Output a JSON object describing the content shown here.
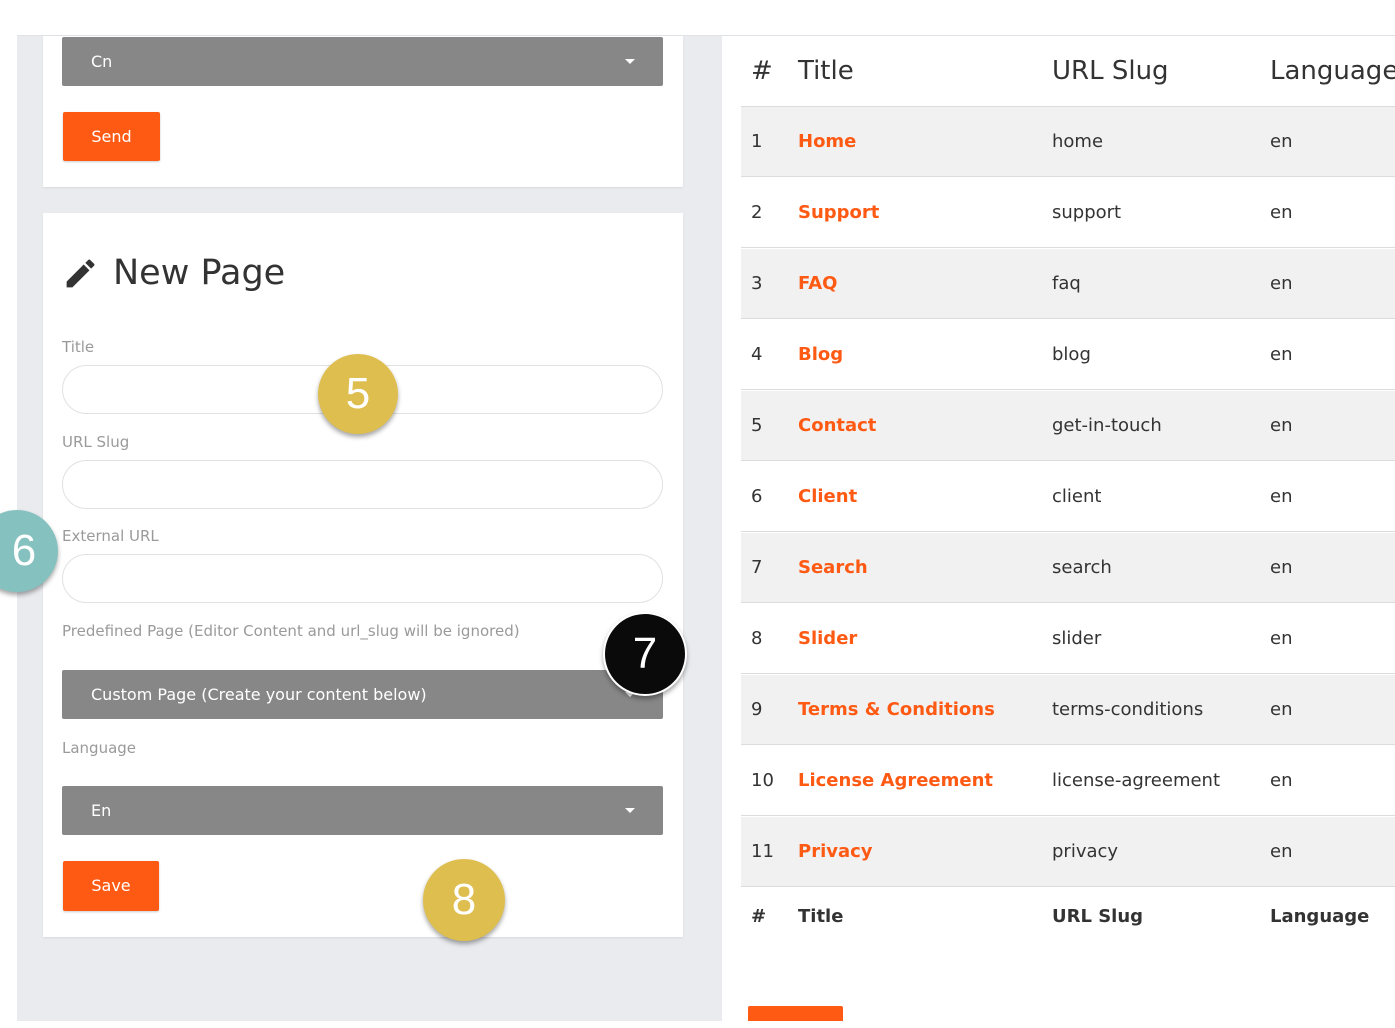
{
  "top_form": {
    "language_select_value": "Cn",
    "send_label": "Send"
  },
  "new_page": {
    "heading": "New Page",
    "title_label": "Title",
    "title_value": "",
    "url_slug_label": "URL Slug",
    "url_slug_value": "",
    "external_url_label": "External URL",
    "external_url_value": "",
    "predefined_label": "Predefined Page (Editor Content and url_slug will be ignored)",
    "predefined_value": "Custom Page (Create your content below)",
    "language_label": "Language",
    "language_value": "En",
    "save_label": "Save"
  },
  "badges": {
    "b5": "5",
    "b6": "6",
    "b7": "7",
    "b8": "8"
  },
  "colors": {
    "accent": "#ff5a14",
    "select_bg": "#878787",
    "badge_gold": "#dfbe50",
    "badge_teal": "#84c1bf"
  },
  "pages_table": {
    "columns": [
      "#",
      "Title",
      "URL Slug",
      "Language"
    ],
    "rows": [
      {
        "num": "1",
        "title": "Home",
        "slug": "home",
        "lang": "en"
      },
      {
        "num": "2",
        "title": "Support",
        "slug": "support",
        "lang": "en"
      },
      {
        "num": "3",
        "title": "FAQ",
        "slug": "faq",
        "lang": "en"
      },
      {
        "num": "4",
        "title": "Blog",
        "slug": "blog",
        "lang": "en"
      },
      {
        "num": "5",
        "title": "Contact",
        "slug": "get-in-touch",
        "lang": "en"
      },
      {
        "num": "6",
        "title": "Client",
        "slug": "client",
        "lang": "en"
      },
      {
        "num": "7",
        "title": "Search",
        "slug": "search",
        "lang": "en"
      },
      {
        "num": "8",
        "title": "Slider",
        "slug": "slider",
        "lang": "en"
      },
      {
        "num": "9",
        "title": "Terms & Conditions",
        "slug": "terms-conditions",
        "lang": "en"
      },
      {
        "num": "10",
        "title": "License Agreement",
        "slug": "license-agreement",
        "lang": "en"
      },
      {
        "num": "11",
        "title": "Privacy",
        "slug": "privacy",
        "lang": "en"
      }
    ],
    "footer": [
      "#",
      "Title",
      "URL Slug",
      "Language"
    ]
  }
}
